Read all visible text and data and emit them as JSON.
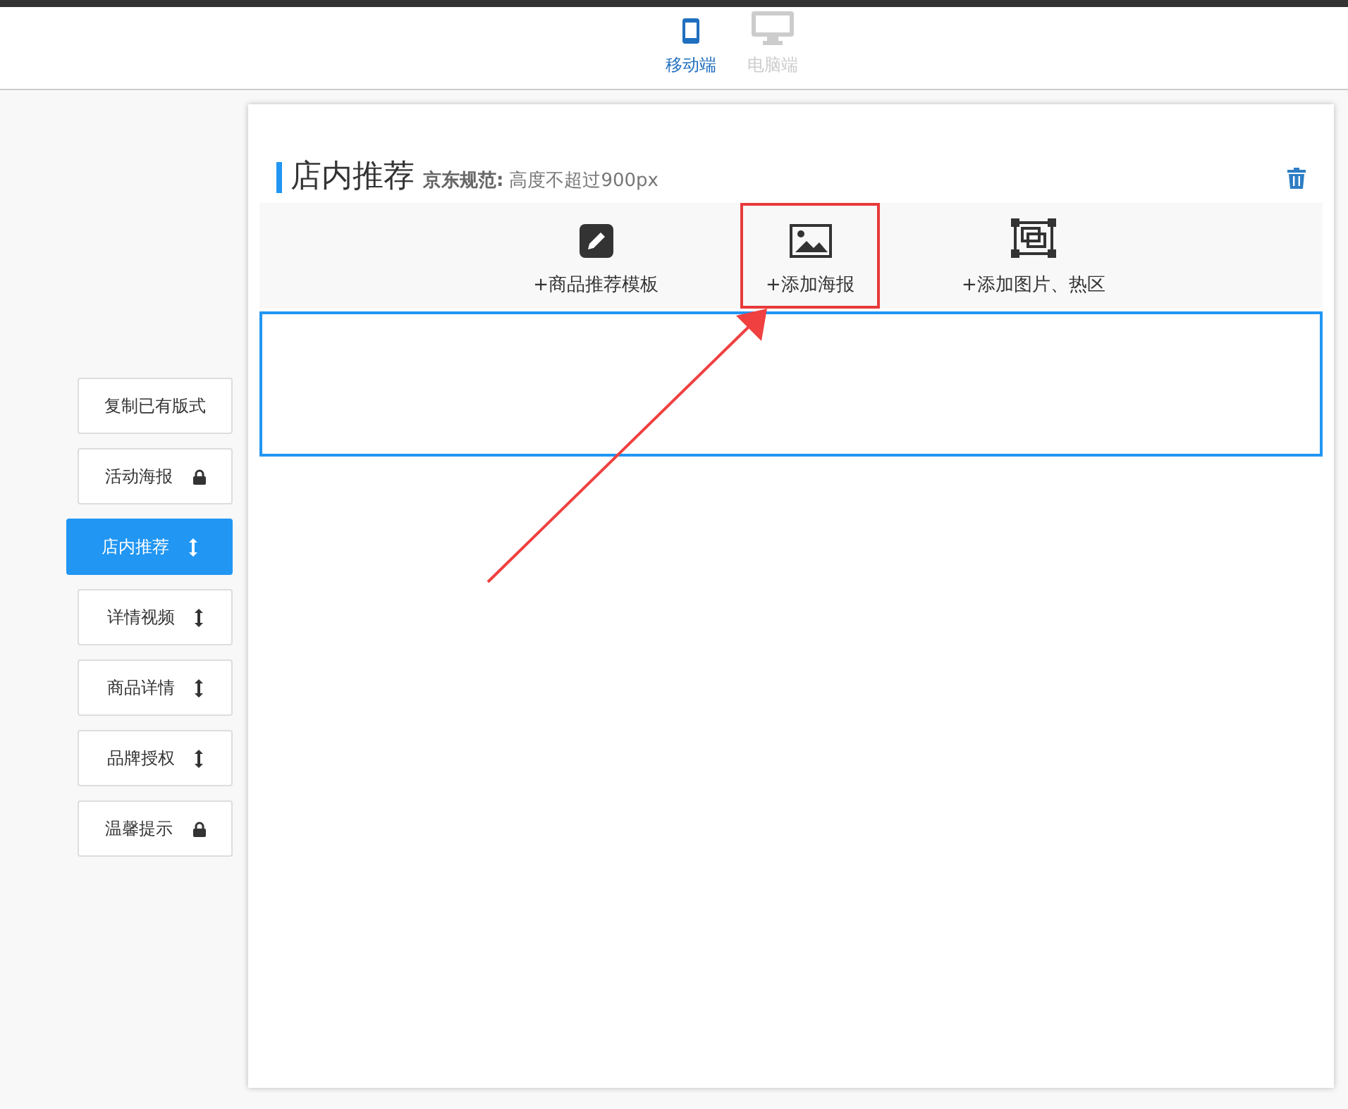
{
  "device_tabs": [
    {
      "label": "移动端",
      "kind": "mobile",
      "selected": true
    },
    {
      "label": "电脑端",
      "kind": "desktop",
      "selected": false
    }
  ],
  "sidebar": {
    "items": [
      {
        "label": "复制已有版式",
        "kind": "plain",
        "selected": false
      },
      {
        "label": "活动海报",
        "kind": "lock",
        "selected": false
      },
      {
        "label": "店内推荐",
        "kind": "move",
        "selected": true
      },
      {
        "label": "详情视频",
        "kind": "move",
        "selected": false
      },
      {
        "label": "商品详情",
        "kind": "move",
        "selected": false
      },
      {
        "label": "品牌授权",
        "kind": "move",
        "selected": false
      },
      {
        "label": "温馨提示",
        "kind": "lock",
        "selected": false
      }
    ]
  },
  "section": {
    "title": "店内推荐",
    "rule_label": "京东规范:",
    "rule_text": "高度不超过900px"
  },
  "add_options": [
    {
      "label": "+商品推荐模板",
      "kind": "edit",
      "highlighted": false
    },
    {
      "label": "+添加海报",
      "kind": "image",
      "highlighted": true
    },
    {
      "label": "+添加图片、热区",
      "kind": "frame",
      "highlighted": false
    }
  ]
}
